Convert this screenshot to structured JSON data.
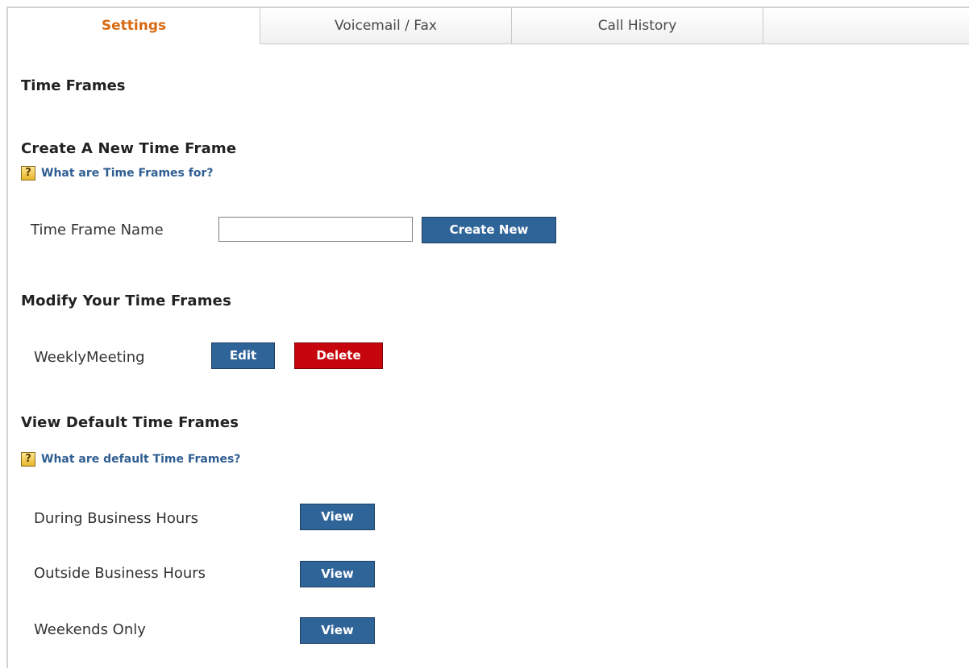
{
  "tabs": [
    {
      "label": "Settings",
      "active": true
    },
    {
      "label": "Voicemail / Fax",
      "active": false
    },
    {
      "label": "Call History",
      "active": false
    }
  ],
  "page": {
    "title": "Time Frames"
  },
  "create_section": {
    "heading": "Create A New Time Frame",
    "help_text": "What are Time Frames for?",
    "field_label": "Time Frame Name",
    "field_value": "",
    "button_label": "Create New"
  },
  "modify_section": {
    "heading": "Modify Your Time Frames",
    "items": [
      {
        "name": "WeeklyMeeting",
        "edit_label": "Edit",
        "delete_label": "Delete"
      }
    ]
  },
  "default_section": {
    "heading": "View Default Time Frames",
    "help_text": "What are default Time Frames?",
    "items": [
      {
        "name": "During Business Hours",
        "view_label": "View"
      },
      {
        "name": "Outside Business Hours",
        "view_label": "View"
      },
      {
        "name": "Weekends Only",
        "view_label": "View"
      }
    ]
  },
  "icons": {
    "help": "help-question-icon"
  },
  "colors": {
    "active_tab_text": "#d86a12",
    "link_blue": "#2f5e92",
    "button_blue": "#2f6498",
    "button_red": "#c7050d"
  }
}
